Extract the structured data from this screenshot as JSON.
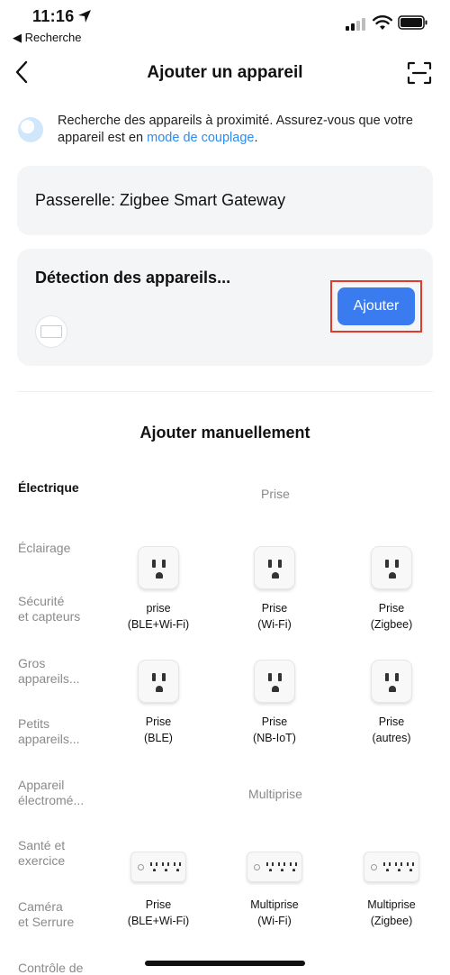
{
  "status_bar": {
    "time": "11:16",
    "back_app": "◀ Recherche"
  },
  "nav": {
    "title": "Ajouter un appareil",
    "back_icon": "chevron-left-icon",
    "scan_icon": "scan-icon"
  },
  "info": {
    "text_before": "Recherche des appareils à proximité. Assurez-vous que votre appareil est en ",
    "link": "mode de couplage",
    "text_after": "."
  },
  "gateway": {
    "label": "Passerelle: Zigbee Smart Gateway"
  },
  "detection": {
    "title": "Détection des appareils...",
    "add_button": "Ajouter"
  },
  "manual": {
    "title": "Ajouter manuellement"
  },
  "categories": [
    {
      "label": "Électrique",
      "active": true
    },
    {
      "label": "Éclairage",
      "active": false
    },
    {
      "label": "Sécurité\net capteurs",
      "active": false
    },
    {
      "label": "Gros\nappareils...",
      "active": false
    },
    {
      "label": "Petits\nappareils...",
      "active": false
    },
    {
      "label": "Appareil\nélectromé...",
      "active": false
    },
    {
      "label": "Santé et\nexercice",
      "active": false
    },
    {
      "label": "Caméra\net Serrure",
      "active": false
    },
    {
      "label": "Contrôle de",
      "active": false
    }
  ],
  "groups": [
    {
      "label": "Prise",
      "items": [
        {
          "label": "prise\n(BLE+Wi-Fi)",
          "icon": "plug-icon"
        },
        {
          "label": "Prise\n(Wi-Fi)",
          "icon": "plug-icon"
        },
        {
          "label": "Prise\n(Zigbee)",
          "icon": "plug-icon"
        },
        {
          "label": "Prise\n(BLE)",
          "icon": "plug-icon"
        },
        {
          "label": "Prise\n(NB-IoT)",
          "icon": "plug-icon"
        },
        {
          "label": "Prise\n(autres)",
          "icon": "plug-icon"
        }
      ]
    },
    {
      "label": "Multiprise",
      "items": [
        {
          "label": "Prise\n(BLE+Wi-Fi)",
          "icon": "power-strip-icon"
        },
        {
          "label": "Multiprise\n(Wi-Fi)",
          "icon": "power-strip-icon"
        },
        {
          "label": "Multiprise\n(Zigbee)",
          "icon": "power-strip-icon"
        }
      ]
    }
  ],
  "colors": {
    "accent": "#3a7cf0",
    "link": "#2d8cf0",
    "highlight_border": "#e03a2f",
    "card_bg": "#f4f5f7"
  }
}
